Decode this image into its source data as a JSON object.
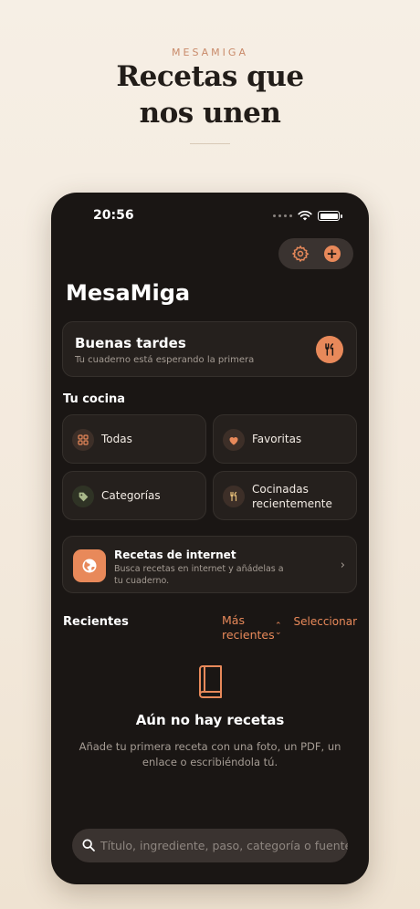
{
  "hero": {
    "brand": "MESAMIGA",
    "headline_line1": "Recetas que",
    "headline_line2": "nos unen"
  },
  "status_bar": {
    "time": "20:56"
  },
  "app": {
    "title": "MesaMiga",
    "greeting": {
      "title": "Buenas tardes",
      "subtitle": "Tu cuaderno está esperando la primera"
    },
    "kitchen": {
      "label": "Tu cocina",
      "tiles": [
        {
          "label": "Todas",
          "icon": "grid-icon"
        },
        {
          "label": "Favoritas",
          "icon": "heart-icon"
        },
        {
          "label": "Categorías",
          "icon": "tag-icon"
        },
        {
          "label": "Cocinadas recientemente",
          "icon": "utensils-icon"
        }
      ]
    },
    "internet": {
      "title": "Recetas de internet",
      "subtitle": "Busca recetas en internet y añádelas a tu cuaderno."
    },
    "recent": {
      "label": "Recientes",
      "sort_line1": "Más",
      "sort_line2": "recientes",
      "select_label": "Seleccionar"
    },
    "empty": {
      "title": "Aún no hay recetas",
      "subtitle": "Añade tu primera receta con una foto, un PDF, un enlace o escribiéndola tú."
    },
    "search": {
      "placeholder": "Título, ingrediente, paso, categoría o fuente"
    }
  },
  "colors": {
    "accent": "#e8895a",
    "background": "#1a1614",
    "card": "#25201d"
  }
}
